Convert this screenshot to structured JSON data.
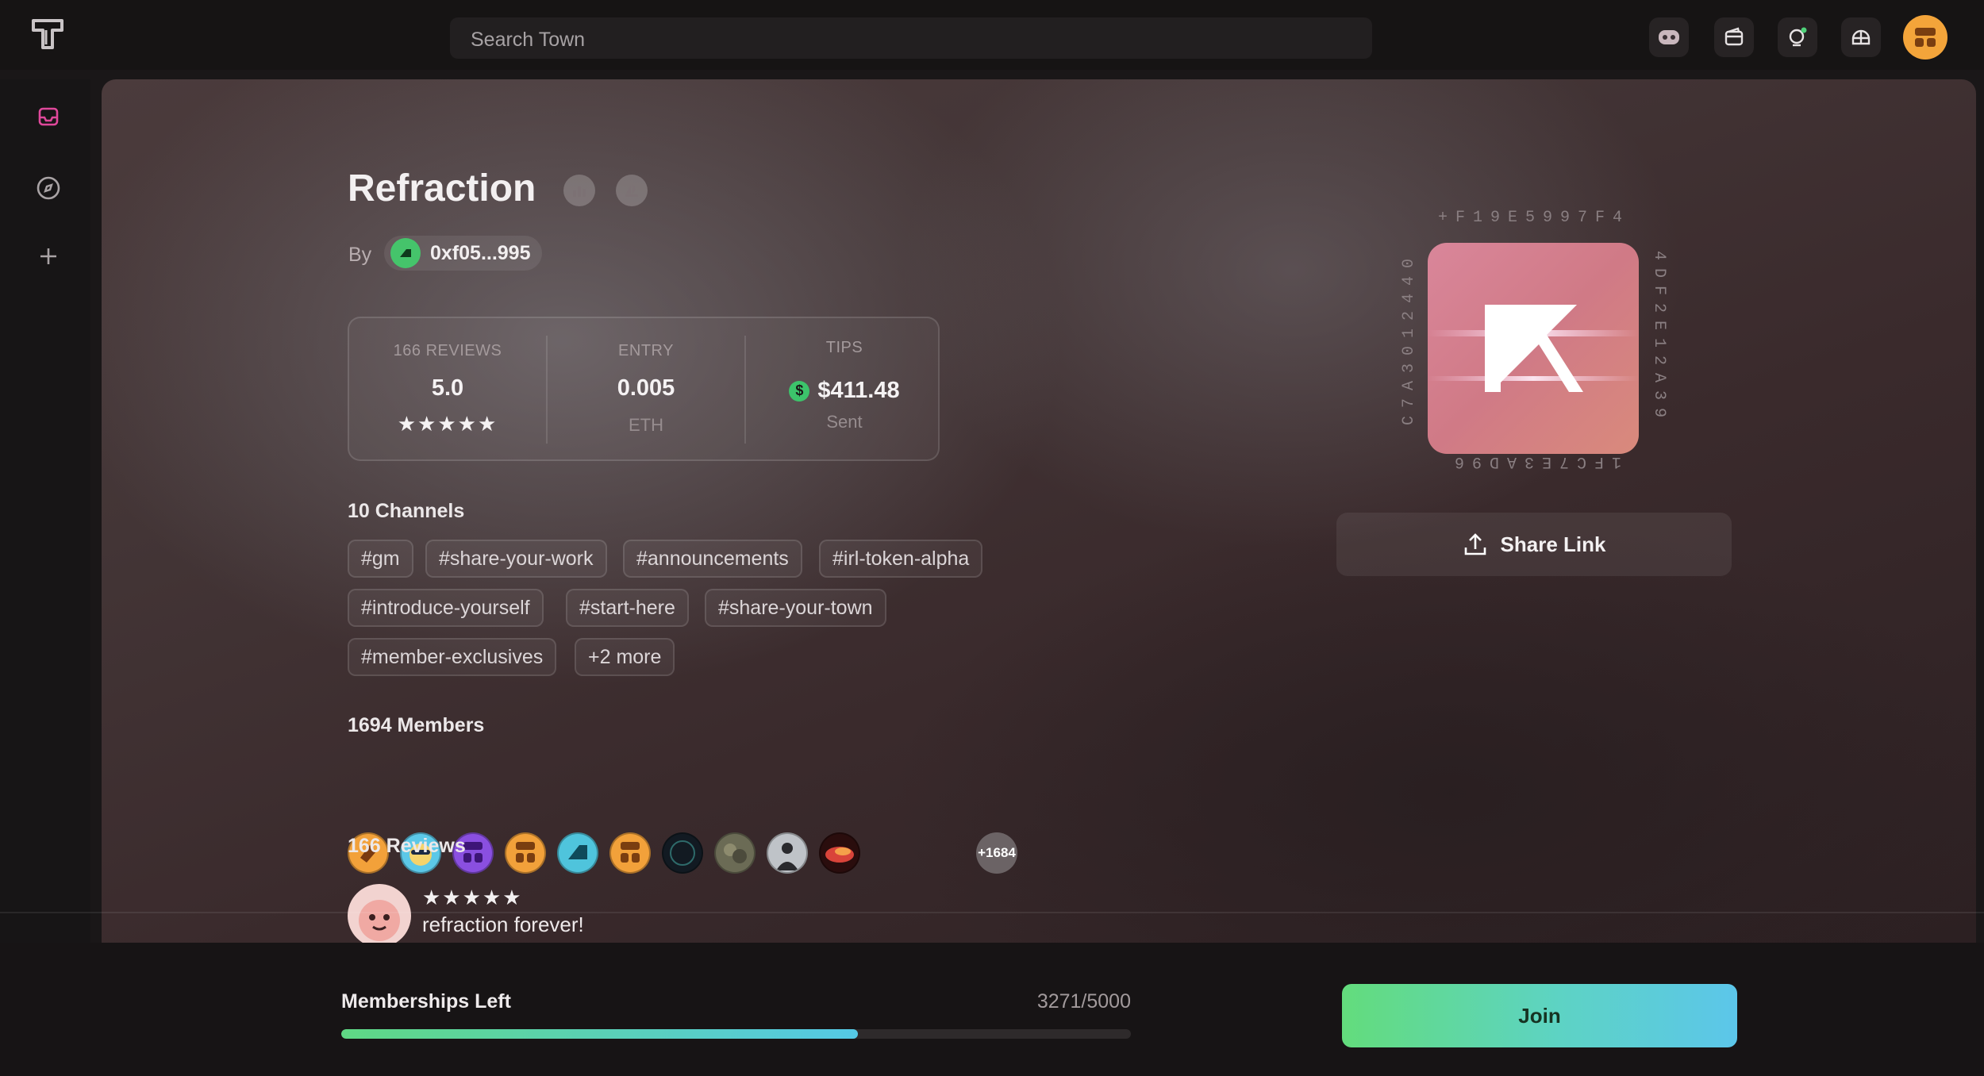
{
  "topbar": {
    "search_placeholder": "Search Town",
    "icons": [
      "bot-icon",
      "wallet-icon",
      "notification-icon",
      "helmet-icon",
      "user-avatar"
    ]
  },
  "sidebar": {
    "items": [
      "inbox-icon",
      "explore-icon",
      "add-icon"
    ]
  },
  "town": {
    "name": "Refraction",
    "by_label": "By",
    "owner": "0xf05...995",
    "ring_text": "+F19E5997F44DF2E12A39F1CF3E7A9D96C7A3012440",
    "image_letter": "R"
  },
  "stats": {
    "reviews_label": "166 REVIEWS",
    "rating": "5.0",
    "stars": "★★★★★",
    "entry_label": "ENTRY",
    "entry_value": "0.005",
    "entry_unit": "ETH",
    "tips_label": "TIPS",
    "tips_value": "$411.48",
    "tips_sub": "Sent",
    "coin_symbol": "$"
  },
  "channels": {
    "heading": "10 Channels",
    "tags": [
      "#gm",
      "#share-your-work",
      "#announcements",
      "#irl-token-alpha",
      "#introduce-yourself",
      "#start-here",
      "#share-your-town",
      "#member-exclusives",
      "+2 more"
    ]
  },
  "members": {
    "heading": "1694 Members",
    "more": "+1684",
    "colors": [
      "#f2a13a",
      "#5cc8e8",
      "#8a4fe0",
      "#f2a13a",
      "#4fc4dc",
      "#f2a13a",
      "#121a22",
      "#6b6b55",
      "#bfc3c8",
      "#d9443a"
    ]
  },
  "reviews": {
    "heading": "166 Reviews",
    "first": {
      "stars": "★★★★★",
      "text": "refraction forever!"
    }
  },
  "share": {
    "label": "Share Link"
  },
  "membership": {
    "label": "Memberships Left",
    "count": "3271/5000",
    "progress": 0.6542
  },
  "join": {
    "label": "Join"
  },
  "colors": {
    "accent_green": "#5fd884",
    "accent_blue": "#55c9e6",
    "owner_avatar": "#45c46b",
    "user_avatar": "#f3a43a"
  }
}
